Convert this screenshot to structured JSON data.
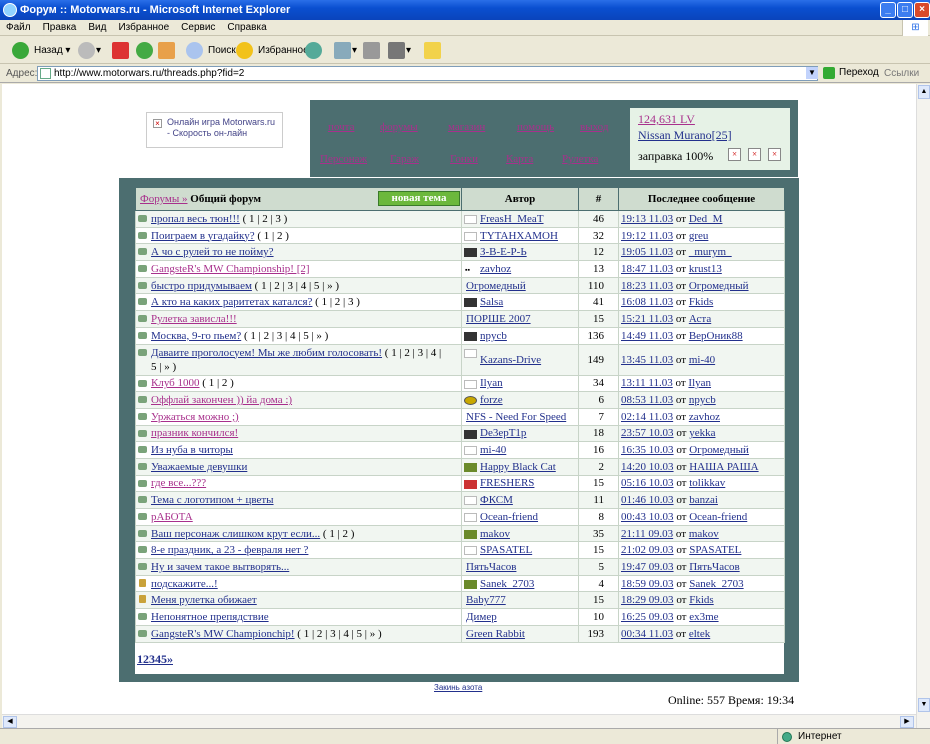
{
  "window": {
    "title": "Форум :: Motorwars.ru - Microsoft Internet Explorer"
  },
  "menu": [
    "Файл",
    "Правка",
    "Вид",
    "Избранное",
    "Сервис",
    "Справка"
  ],
  "toolbar": {
    "back": "Назад",
    "search": "Поиск",
    "favorites": "Избранное"
  },
  "address": {
    "label": "Адрес:",
    "url": "http://www.motorwars.ru/threads.php?fid=2",
    "go": "Переход",
    "links": "Ссылки"
  },
  "status": {
    "zone": "Интернет"
  },
  "promo": {
    "text": "Онлайн игра Motorwars.ru - Скорость он-лайн"
  },
  "nav": {
    "row1": [
      "почта",
      "форумы",
      "магазин",
      "помощь",
      "выход"
    ],
    "row2": [
      "Персонаж",
      "Гараж",
      "Гонки",
      "Карта",
      "Рулетка"
    ]
  },
  "info": {
    "money": "124,631 LV",
    "car": "Nissan Murano[25]",
    "fuel": "заправка 100%"
  },
  "forum": {
    "crumb": "Форумы »",
    "title": "Общий форум",
    "new_topic": "новая тема",
    "headers": {
      "author": "Автор",
      "count": "#",
      "last": "Последнее сообщение"
    },
    "threads": [
      {
        "icon": "msg",
        "title": "пропал весь тюн!!!",
        "visited": false,
        "pages": "( 1 | 2 | 3 )",
        "author": "FreasH_MeaT",
        "av": "plain",
        "count": "46",
        "date": "19:13 11.03",
        "from": "от",
        "last": "Ded_M"
      },
      {
        "icon": "msg",
        "title": "Поиграем в угадайку?",
        "visited": false,
        "pages": "( 1 | 2 )",
        "author": "TYTAHXAMOH",
        "av": "plain",
        "count": "32",
        "date": "19:12 11.03",
        "from": "от",
        "last": "greu"
      },
      {
        "icon": "msg",
        "title": "А чо с рулей то не пойму?",
        "visited": false,
        "pages": "",
        "author": "З-В-Е-Р-Ь",
        "av": "pic",
        "count": "12",
        "date": "19:05 11.03",
        "from": "от",
        "last": "_murym_"
      },
      {
        "icon": "msg",
        "title": "GangsteR's MW Championship! [2]",
        "visited": true,
        "pages": "",
        "author": "zavhoz",
        "av": "txt",
        "count": "13",
        "date": "18:47 11.03",
        "from": "от",
        "last": "krust13"
      },
      {
        "icon": "msg",
        "title": "быстро придумываем",
        "visited": false,
        "pages": "( 1 | 2 | 3 | 4 | 5 | » )",
        "author": "Огромедный",
        "av": "none",
        "count": "110",
        "date": "18:23 11.03",
        "from": "от",
        "last": "Огромедный"
      },
      {
        "icon": "msg",
        "title": "А кто на каких раритетах катался?",
        "visited": false,
        "pages": "( 1 | 2 | 3 )",
        "author": "Salsa",
        "av": "pic",
        "count": "41",
        "date": "16:08 11.03",
        "from": "от",
        "last": "Fkids"
      },
      {
        "icon": "msg",
        "title": "Рулетка зависла!!!",
        "visited": true,
        "pages": "",
        "author": "ПОРШЕ 2007",
        "av": "none",
        "count": "15",
        "date": "15:21 11.03",
        "from": "от",
        "last": "Аста"
      },
      {
        "icon": "msg",
        "title": "Москва, 9-го пьем?",
        "visited": false,
        "pages": "( 1 | 2 | 3 | 4 | 5 | » )",
        "author": "npycb",
        "av": "pic",
        "count": "136",
        "date": "14:49 11.03",
        "from": "от",
        "last": "ВерОник88"
      },
      {
        "icon": "msg",
        "title": "Даваите проголосуем! Мы же любим голосовать!",
        "visited": false,
        "pages": "( 1 | 2 | 3 | 4 |",
        "pages2": "5 | » )",
        "author": "Kazans-Drive",
        "av": "plain",
        "count": "149",
        "date": "13:45 11.03",
        "from": "от",
        "last": "mi-40"
      },
      {
        "icon": "msg",
        "title": "Клуб 1000",
        "visited": true,
        "pages": "( 1 | 2 )",
        "author": "Ilyan",
        "av": "plain",
        "count": "34",
        "date": "13:11 11.03",
        "from": "от",
        "last": "Ilyan"
      },
      {
        "icon": "msg",
        "title": "Оффлай закончен )) йа дома :)",
        "visited": true,
        "pages": "",
        "author": "forze",
        "av": "yel",
        "count": "6",
        "date": "08:53 11.03",
        "from": "от",
        "last": "npycb"
      },
      {
        "icon": "msg",
        "title": "Уржаться можно ;)",
        "visited": true,
        "pages": "",
        "author": "NFS - Need For Speed",
        "av": "none",
        "count": "7",
        "date": "02:14 11.03",
        "from": "от",
        "last": "zavhoz"
      },
      {
        "icon": "msg",
        "title": "празник кончился!",
        "visited": true,
        "pages": "",
        "author": "De3epT1p",
        "av": "pic",
        "count": "18",
        "date": "23:57 10.03",
        "from": "от",
        "last": "yekka"
      },
      {
        "icon": "msg",
        "title": "Из нуба в читоры",
        "visited": false,
        "pages": "",
        "author": "mi-40",
        "av": "plain",
        "count": "16",
        "date": "16:35 10.03",
        "from": "от",
        "last": "Огромедный"
      },
      {
        "icon": "msg",
        "title": "Уважаемые девушки",
        "visited": false,
        "pages": "",
        "author": "Happy Black Cat",
        "av": "grn",
        "count": "2",
        "date": "14:20 10.03",
        "from": "от",
        "last": "НАША РАША"
      },
      {
        "icon": "msg",
        "title": "где все...???",
        "visited": true,
        "pages": "",
        "author": "FRESHERS",
        "av": "red",
        "count": "15",
        "date": "05:16 10.03",
        "from": "от",
        "last": "tolikkav"
      },
      {
        "icon": "msg",
        "title": "Тема с логотипом + цветы",
        "visited": false,
        "pages": "",
        "author": "ФКСМ",
        "av": "plain",
        "count": "11",
        "date": "01:46 10.03",
        "from": "от",
        "last": "banzai"
      },
      {
        "icon": "msg",
        "title": "рАБОТА",
        "visited": true,
        "pages": "",
        "author": "Ocean-friend",
        "av": "plain",
        "count": "8",
        "date": "00:43 10.03",
        "from": "от",
        "last": "Ocean-friend"
      },
      {
        "icon": "msg",
        "title": "Ваш персонаж слишком крут если...",
        "visited": false,
        "pages": "( 1 | 2 )",
        "author": "makov",
        "av": "grn",
        "count": "35",
        "date": "21:11 09.03",
        "from": "от",
        "last": "makov"
      },
      {
        "icon": "msg",
        "title": "8-е праздник, а 23 - февраля нет ?",
        "visited": false,
        "pages": "",
        "author": "SPASATEL",
        "av": "plain",
        "count": "15",
        "date": "21:02 09.03",
        "from": "от",
        "last": "SPASATEL"
      },
      {
        "icon": "msg",
        "title": "Ну и зачем такое вытворять...",
        "visited": false,
        "pages": "",
        "author": "ПятьЧасов",
        "av": "none",
        "count": "5",
        "date": "19:47 09.03",
        "from": "от",
        "last": "ПятьЧасов"
      },
      {
        "icon": "lock",
        "title": "подскажите...!",
        "visited": false,
        "pages": "",
        "author": "Sanek_2703",
        "av": "grn",
        "count": "4",
        "date": "18:59 09.03",
        "from": "от",
        "last": "Sanek_2703"
      },
      {
        "icon": "lock",
        "title": "Меня рулетка обижает",
        "visited": false,
        "pages": "",
        "author": "Baby777",
        "av": "none",
        "count": "15",
        "date": "18:29 09.03",
        "from": "от",
        "last": "Fkids"
      },
      {
        "icon": "msg",
        "title": "Непонятное препядствие",
        "visited": false,
        "pages": "",
        "author": "Димер",
        "av": "none",
        "count": "10",
        "date": "16:25 09.03",
        "from": "от",
        "last": "ex3me"
      },
      {
        "icon": "msg",
        "title": "GangsteR's MW Championchip!",
        "visited": false,
        "pages": "( 1 | 2 | 3 | 4 | 5 | » )",
        "author": "Green Rabbit",
        "av": "none",
        "count": "193",
        "date": "00:34 11.03",
        "from": "от",
        "last": "eltek"
      }
    ],
    "pagination": "12345»"
  },
  "footer": {
    "link": "Закинь азота",
    "online_label": "Online:",
    "online_count": "557",
    "time_label": "Время:",
    "time": "19:34"
  }
}
